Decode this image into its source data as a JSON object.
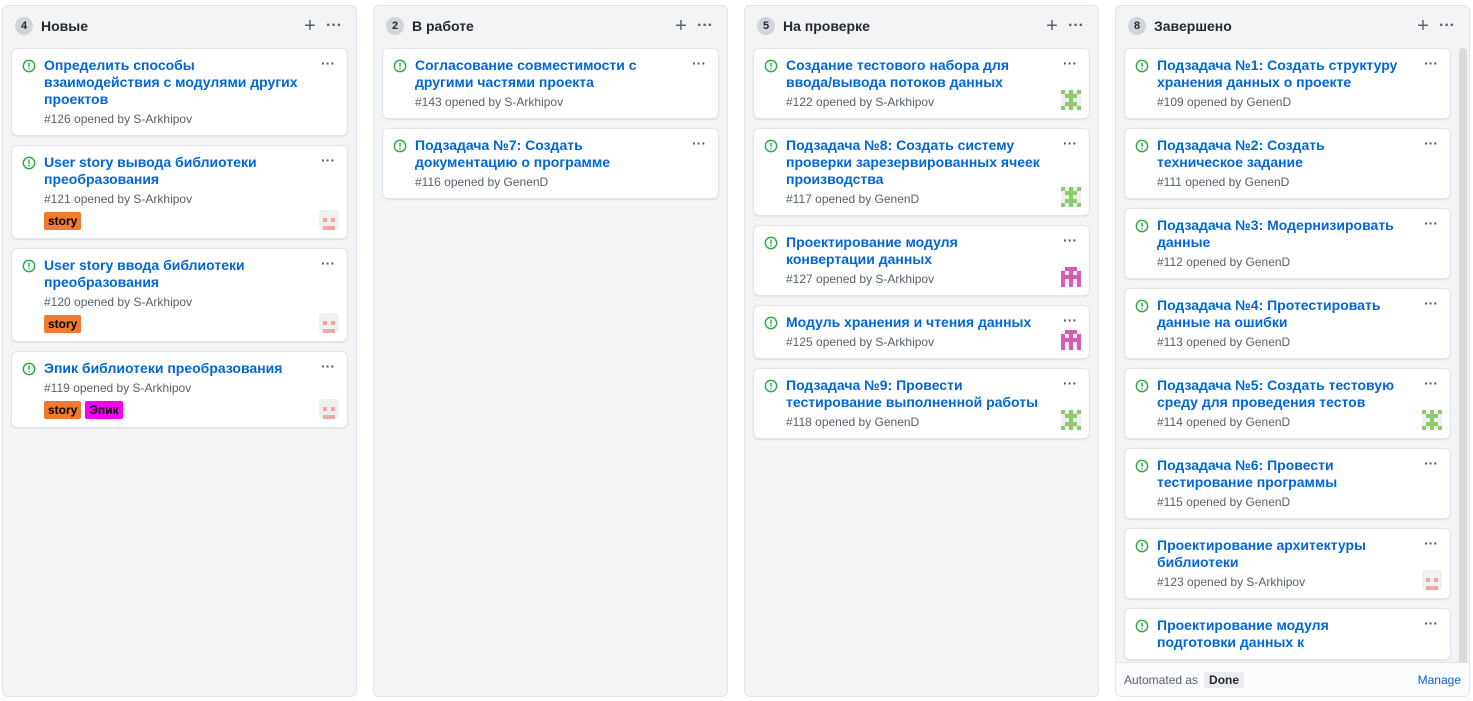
{
  "colors": {
    "story": "#ee7b2f",
    "epic": "#f500f1",
    "link": "#0366d6",
    "open_icon": "#28a745"
  },
  "columns": [
    {
      "count": "4",
      "title": "Новые",
      "cards": [
        {
          "title": "Определить способы взаимодействия с модулями других проектов",
          "meta": "#126 opened by S-Arkhipov",
          "labels": [],
          "avatar": ""
        },
        {
          "title": "User story вывода библиотеки преобразования",
          "meta": "#121 opened by S-Arkhipov",
          "labels": [
            "story"
          ],
          "avatar": "pink"
        },
        {
          "title": "User story ввода библиотеки преобразования",
          "meta": "#120 opened by S-Arkhipov",
          "labels": [
            "story"
          ],
          "avatar": "pink"
        },
        {
          "title": "Эпик библиотеки преобразования",
          "meta": "#119 opened by S-Arkhipov",
          "labels": [
            "story",
            "Эпик"
          ],
          "avatar": "pink"
        }
      ]
    },
    {
      "count": "2",
      "title": "В работе",
      "cards": [
        {
          "title": "Согласование совместимости с другими частями проекта",
          "meta": "#143 opened by S-Arkhipov",
          "labels": [],
          "avatar": ""
        },
        {
          "title": "Подзадача №7: Создать документацию о программе",
          "meta": "#116 opened by GenenD",
          "labels": [],
          "avatar": ""
        }
      ]
    },
    {
      "count": "5",
      "title": "На проверке",
      "cards": [
        {
          "title": "Создание тестового набора для ввода/вывода потоков данных",
          "meta": "#122 opened by S-Arkhipov",
          "labels": [],
          "avatar": "green"
        },
        {
          "title": "Подзадача №8: Создать систему проверки зарезервированных ячеек производства",
          "meta": "#117 opened by GenenD",
          "labels": [],
          "avatar": "green"
        },
        {
          "title": "Проектирование модуля конвертации данных",
          "meta": "#127 opened by S-Arkhipov",
          "labels": [],
          "avatar": "magenta"
        },
        {
          "title": "Модуль хранения и чтения данных",
          "meta": "#125 opened by S-Arkhipov",
          "labels": [],
          "avatar": "magenta"
        },
        {
          "title": "Подзадача №9: Провести тестирование выполненной работы",
          "meta": "#118 opened by GenenD",
          "labels": [],
          "avatar": "green"
        }
      ]
    },
    {
      "count": "8",
      "title": "Завершено",
      "cards": [
        {
          "title": "Подзадача №1: Создать структуру хранения данных о проекте",
          "meta": "#109 opened by GenenD",
          "labels": [],
          "avatar": ""
        },
        {
          "title": "Подзадача №2: Создать техническое задание",
          "meta": "#111 opened by GenenD",
          "labels": [],
          "avatar": ""
        },
        {
          "title": "Подзадача №3: Модернизировать данные",
          "meta": "#112 opened by GenenD",
          "labels": [],
          "avatar": ""
        },
        {
          "title": "Подзадача №4: Протестировать данные на ошибки",
          "meta": "#113 opened by GenenD",
          "labels": [],
          "avatar": ""
        },
        {
          "title": "Подзадача №5: Создать тестовую среду для проведения тестов",
          "meta": "#114 opened by GenenD",
          "labels": [],
          "avatar": "green"
        },
        {
          "title": "Подзадача №6: Провести тестирование программы",
          "meta": "#115 opened by GenenD",
          "labels": [],
          "avatar": ""
        },
        {
          "title": "Проектирование архитектуры библиотеки",
          "meta": "#123 opened by S-Arkhipov",
          "labels": [],
          "avatar": "pink"
        },
        {
          "title": "Проектирование модуля подготовки данных к",
          "meta": "",
          "labels": [],
          "avatar": ""
        }
      ],
      "footer": {
        "automated": "Automated as",
        "done": "Done",
        "manage": "Manage"
      }
    }
  ]
}
